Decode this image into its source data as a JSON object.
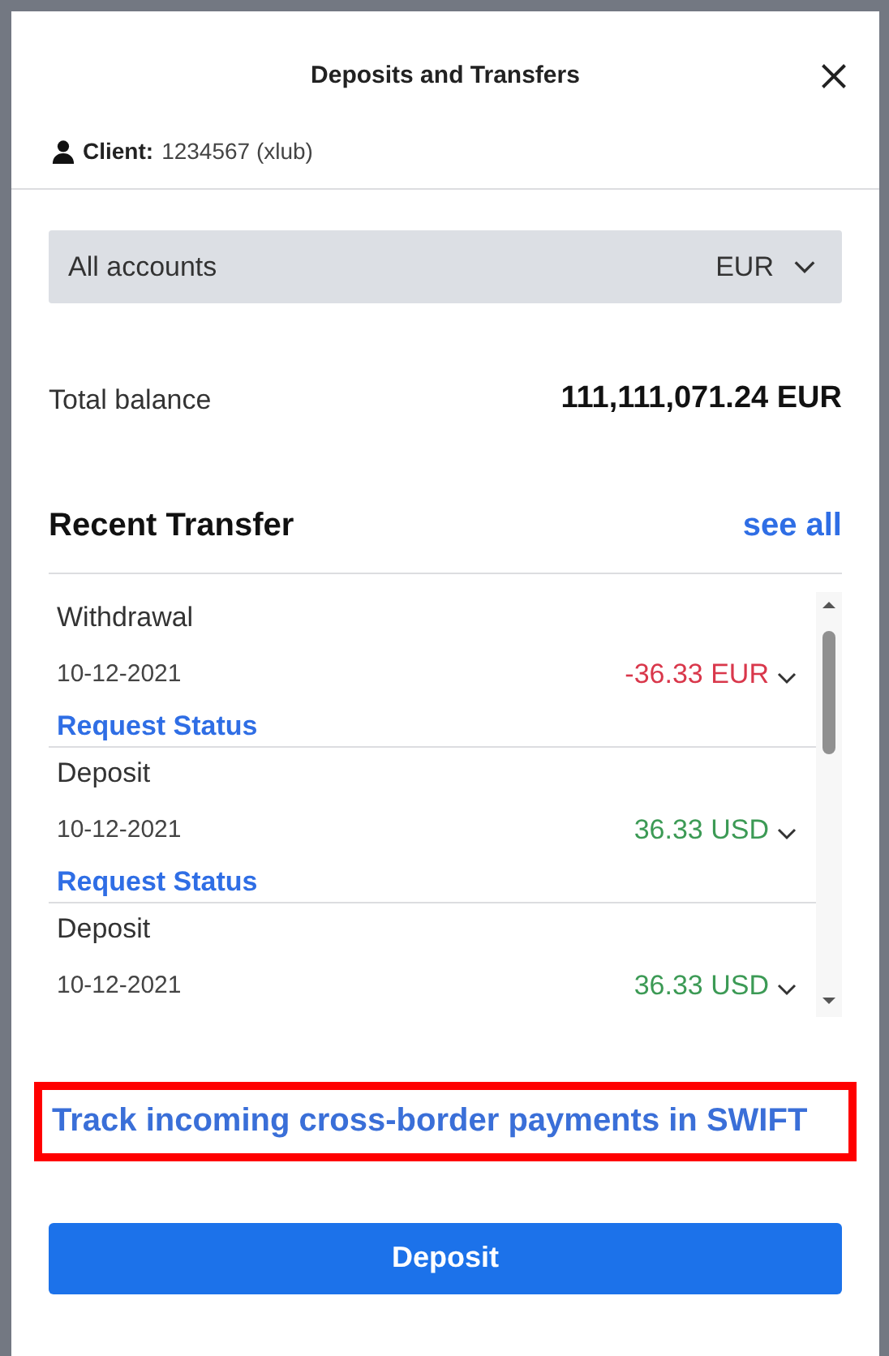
{
  "window": {
    "title": "Deposits and Transfers"
  },
  "client": {
    "label": "Client:",
    "value": "1234567 (xlub)"
  },
  "account_select": {
    "value": "All accounts",
    "currency": "EUR"
  },
  "balance": {
    "label": "Total balance",
    "value": "111,111,071.24 EUR"
  },
  "recent": {
    "title": "Recent Transfer",
    "link": "see all",
    "rows": [
      {
        "type": "Withdrawal",
        "date": "10-12-2021",
        "amount": "-36.33 EUR",
        "kind": "debit",
        "status_link": "Request Status"
      },
      {
        "type": "Deposit",
        "date": "10-12-2021",
        "amount": "36.33 USD",
        "kind": "credit",
        "status_link": "Request Status"
      },
      {
        "type": "Deposit",
        "date": "10-12-2021",
        "amount": "36.33 USD",
        "kind": "credit"
      }
    ]
  },
  "swift_link": {
    "text": "Track incoming cross-border payments in SWIFT",
    "highlighted": true
  },
  "buttons": [
    "Deposit"
  ]
}
